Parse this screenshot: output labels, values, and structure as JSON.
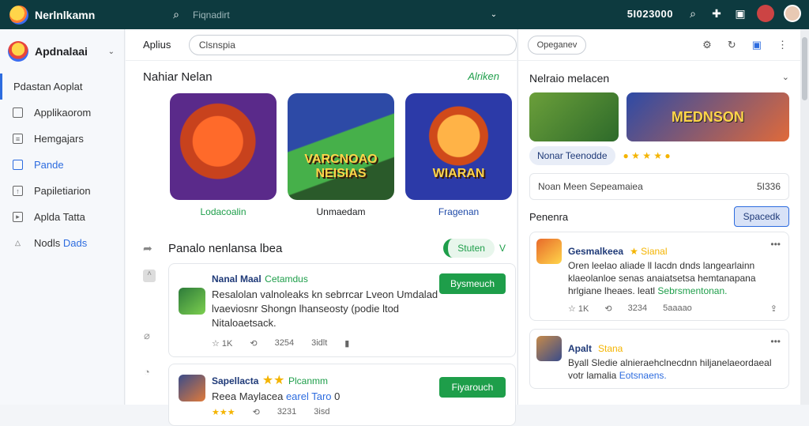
{
  "topbar": {
    "brand": "Nerlnlkamn",
    "search_placeholder": "Fiqnadirt",
    "count": "5I023000",
    "icons": [
      "search-icon",
      "plus-icon",
      "controller-icon",
      "notification-icon",
      "user-avatar"
    ]
  },
  "sidebar": {
    "account_name": "Apdnalaai",
    "items": [
      {
        "label": "Pdastan Aoplat",
        "icon": "none"
      },
      {
        "label": "Applikaorom",
        "icon": "grid-icon"
      },
      {
        "label": "Hemgajars",
        "icon": "list-icon"
      },
      {
        "label": "Pande",
        "icon": "square-icon"
      },
      {
        "label": "Papiletiarion",
        "icon": "upload-icon"
      },
      {
        "label": "Aplda Tatta",
        "icon": "play-icon"
      },
      {
        "label_a": "Nodls",
        "label_b": "Dads",
        "icon": "mountain-icon"
      }
    ]
  },
  "main": {
    "subhead_label": "Aplius",
    "search_value": "Clsnspia",
    "section1": {
      "title": "Nahiar Nelan",
      "more": "Alriken",
      "games": [
        {
          "name": "Lodacoalin",
          "thumb_text": ""
        },
        {
          "name": "Unmaedam",
          "thumb_text": "VARCNOAO NEISIAS"
        },
        {
          "name": "Fragenan",
          "thumb_text": "WIARAN"
        }
      ]
    },
    "section2": {
      "title": "Panalo nenlansa lbea",
      "toggle": "Stuten",
      "toggle_v": "V",
      "posts": [
        {
          "name": "Nanal Maal",
          "tag": "Cetamdus",
          "body": "Resalolan valnoleaks kn sebrrcar Lveon Umdalad lvaeviosnr Shongn lhanseosty (podie ltod Nitaloaetsack.",
          "button": "Bysmeuch",
          "stats": [
            "1K",
            "3254",
            "3idlt"
          ]
        },
        {
          "name": "Sapellacta",
          "tag": "Plcanmm",
          "body": "Reea Maylacea",
          "body_link": "earel Taro",
          "body_num": "0",
          "button": "Fiyarouch",
          "stats": [
            "",
            "3231",
            "3isd"
          ]
        }
      ]
    }
  },
  "right": {
    "option_button": "Opeganev",
    "title": "Nelraio melacen",
    "banner2_text": "MEDNSON",
    "chip": "Nonar Teenodde",
    "box_left": "Noan Meen Sepeamaiea",
    "box_right": "5I336",
    "cat_label": "Penenra",
    "cat_button": "Spacedk",
    "posts": [
      {
        "name": "Gesmalkeea",
        "tag": "Sianal",
        "body": "Oren leelao aliade ll lacdn dnds langearlainn klaeolanloe senas anaiatsetsa hemtanapana hrlgiane lheaes. leatl",
        "body_hl": "Sebrsmentonan.",
        "stats": [
          "1K",
          "3234",
          "5aaaao"
        ]
      },
      {
        "name": "Apalt",
        "tag": "Stana",
        "body": "Byall Sledie alnieraehclnecdnn hiljanelaeordaeal votr lamalia",
        "body_hl": "Eotsnaens."
      }
    ]
  },
  "colors": {
    "topbar": "#0d3a3f",
    "accent_green": "#1e9e4a",
    "accent_blue": "#2d6cdf"
  }
}
